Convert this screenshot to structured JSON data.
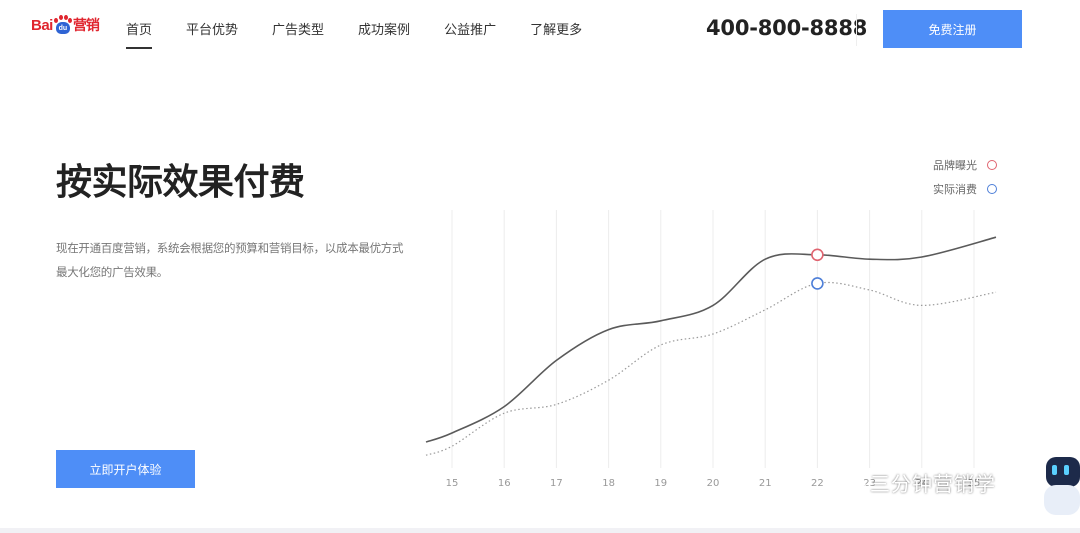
{
  "brand": {
    "logo_text": "Bai",
    "logo_paw": "du",
    "logo_suffix": "营销"
  },
  "nav": [
    {
      "label": "首页",
      "active": true
    },
    {
      "label": "平台优势"
    },
    {
      "label": "广告类型"
    },
    {
      "label": "成功案例"
    },
    {
      "label": "公益推广"
    },
    {
      "label": "了解更多"
    }
  ],
  "header": {
    "phone": "400-800-8888",
    "register_label": "免费注册"
  },
  "hero": {
    "title": "按实际效果付费",
    "description": "现在开通百度营销，系统会根据您的预算和营销目标，以成本最优方式最大化您的广告效果。",
    "cta_label": "立即开户体验"
  },
  "legend": [
    {
      "label": "品牌曝光",
      "color": "#e06470"
    },
    {
      "label": "实际消费",
      "color": "#4e7fd8"
    }
  ],
  "chart_data": {
    "type": "line",
    "x": [
      "15",
      "16",
      "17",
      "18",
      "19",
      "20",
      "21",
      "22",
      "23",
      "24",
      "25"
    ],
    "series": [
      {
        "name": "品牌曝光",
        "style": "solid",
        "values": [
          1.0,
          2.2,
          4.3,
          5.7,
          6.1,
          6.8,
          8.9,
          9.1,
          8.9,
          9.0,
          9.9
        ],
        "marker_at": "22"
      },
      {
        "name": "实际消费",
        "style": "dotted",
        "values": [
          0.4,
          1.9,
          2.3,
          3.4,
          5.0,
          5.5,
          6.6,
          7.8,
          7.5,
          6.8,
          7.4
        ],
        "marker_at": "22"
      }
    ],
    "grid": "vertical"
  },
  "watermark": {
    "text": "三分钟营销学",
    "icon": "wechat-icon"
  }
}
